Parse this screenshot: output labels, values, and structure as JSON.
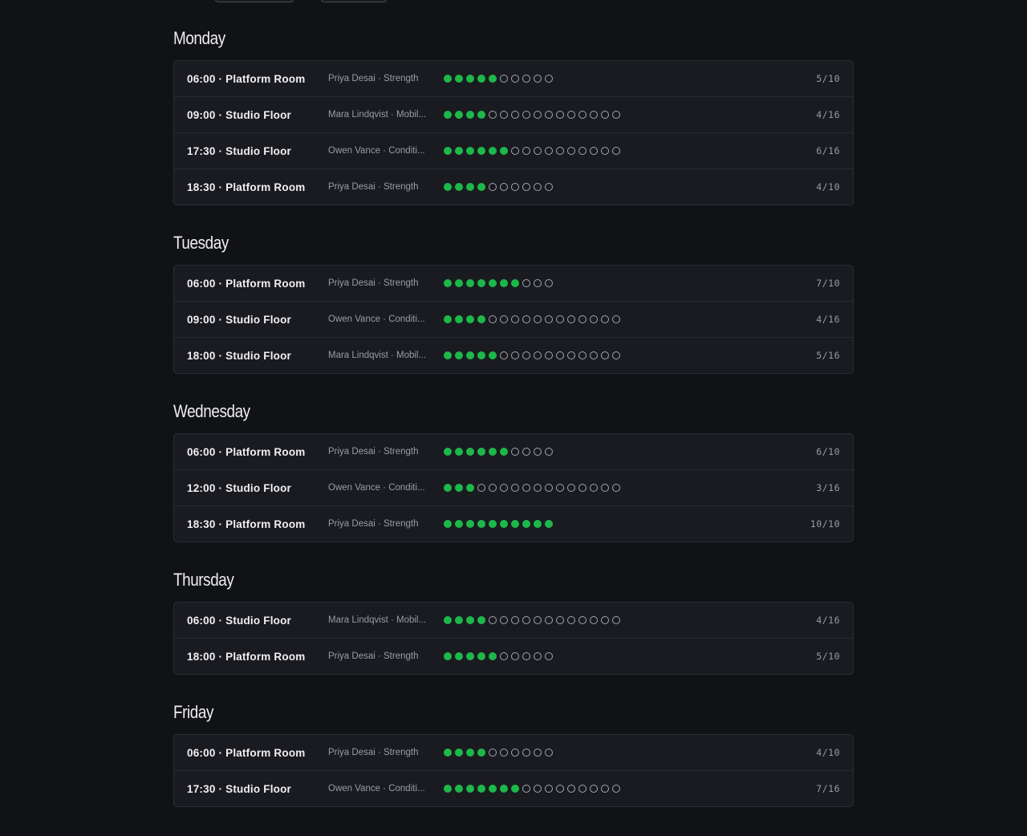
{
  "colors": {
    "background": "#111216",
    "card": "#1a1b20",
    "filled_dot": "#1db84a",
    "empty_dot_border": "#a4a6ad"
  },
  "days": [
    {
      "name": "Monday",
      "sessions": [
        {
          "slot": "06:00 · Platform Room",
          "meta": "Priya Desai · Strength",
          "booked": 5,
          "capacity": 10,
          "count": "5/10"
        },
        {
          "slot": "09:00 · Studio Floor",
          "meta": "Mara Lindqvist · Mobil...",
          "booked": 4,
          "capacity": 16,
          "count": "4/16"
        },
        {
          "slot": "17:30 · Studio Floor",
          "meta": "Owen Vance · Conditi...",
          "booked": 6,
          "capacity": 16,
          "count": "6/16"
        },
        {
          "slot": "18:30 · Platform Room",
          "meta": "Priya Desai · Strength",
          "booked": 4,
          "capacity": 10,
          "count": "4/10"
        }
      ]
    },
    {
      "name": "Tuesday",
      "sessions": [
        {
          "slot": "06:00 · Platform Room",
          "meta": "Priya Desai · Strength",
          "booked": 7,
          "capacity": 10,
          "count": "7/10"
        },
        {
          "slot": "09:00 · Studio Floor",
          "meta": "Owen Vance · Conditi...",
          "booked": 4,
          "capacity": 16,
          "count": "4/16"
        },
        {
          "slot": "18:00 · Studio Floor",
          "meta": "Mara Lindqvist · Mobil...",
          "booked": 5,
          "capacity": 16,
          "count": "5/16"
        }
      ]
    },
    {
      "name": "Wednesday",
      "sessions": [
        {
          "slot": "06:00 · Platform Room",
          "meta": "Priya Desai · Strength",
          "booked": 6,
          "capacity": 10,
          "count": "6/10"
        },
        {
          "slot": "12:00 · Studio Floor",
          "meta": "Owen Vance · Conditi...",
          "booked": 3,
          "capacity": 16,
          "count": "3/16"
        },
        {
          "slot": "18:30 · Platform Room",
          "meta": "Priya Desai · Strength",
          "booked": 10,
          "capacity": 10,
          "count": "10/10"
        }
      ]
    },
    {
      "name": "Thursday",
      "sessions": [
        {
          "slot": "06:00 · Studio Floor",
          "meta": "Mara Lindqvist · Mobil...",
          "booked": 4,
          "capacity": 16,
          "count": "4/16"
        },
        {
          "slot": "18:00 · Platform Room",
          "meta": "Priya Desai · Strength",
          "booked": 5,
          "capacity": 10,
          "count": "5/10"
        }
      ]
    },
    {
      "name": "Friday",
      "sessions": [
        {
          "slot": "06:00 · Platform Room",
          "meta": "Priya Desai · Strength",
          "booked": 4,
          "capacity": 10,
          "count": "4/10"
        },
        {
          "slot": "17:30 · Studio Floor",
          "meta": "Owen Vance · Conditi...",
          "booked": 7,
          "capacity": 16,
          "count": "7/16"
        }
      ]
    }
  ]
}
